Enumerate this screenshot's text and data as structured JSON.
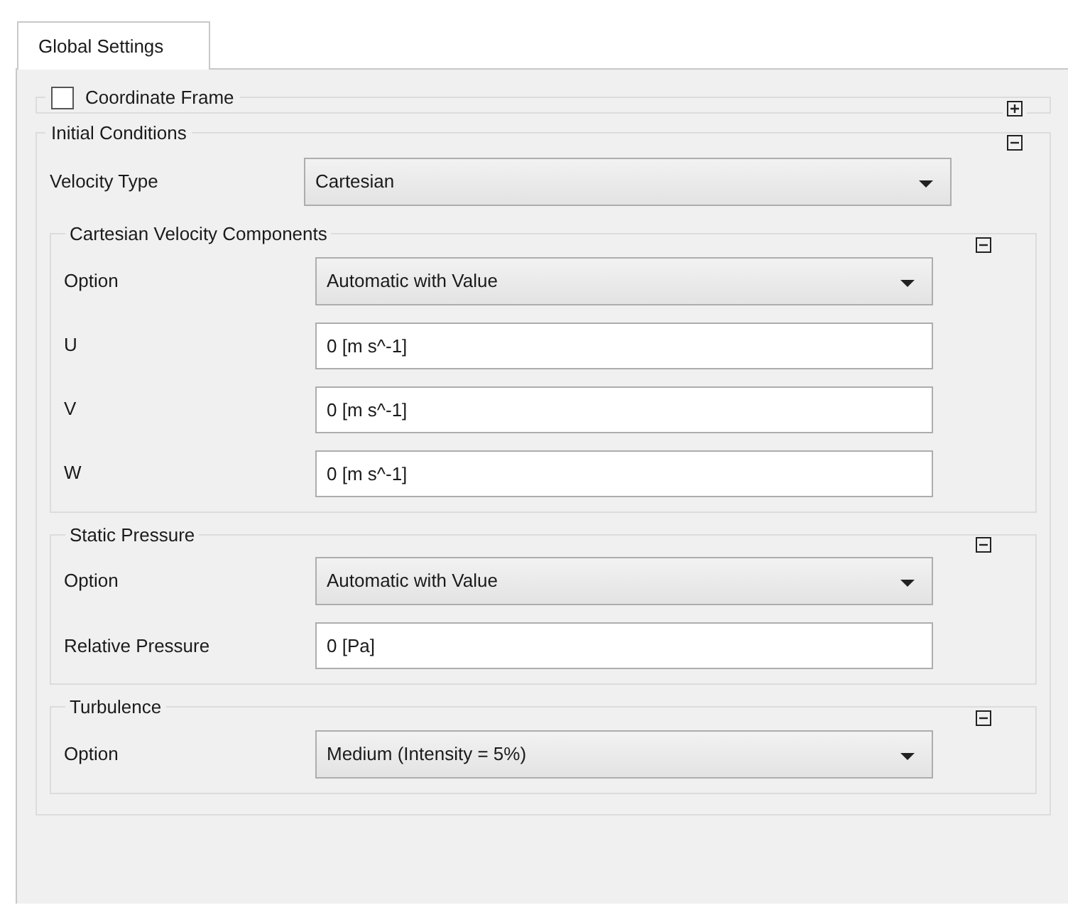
{
  "tabs": [
    {
      "label": "Global Settings",
      "selected": true
    }
  ],
  "sections": [
    {
      "kind": "checkbox",
      "title": "Coordinate Frame",
      "checked": false,
      "expanded": false
    },
    {
      "kind": "group",
      "title": "Initial Conditions",
      "expanded": true,
      "rows": [
        {
          "kind": "dropdown",
          "label": "Velocity Type",
          "value": "Cartesian"
        }
      ],
      "subgroups": [
        {
          "title": "Cartesian Velocity Components",
          "expanded": true,
          "rows": [
            {
              "kind": "dropdown",
              "label": "Option",
              "value": "Automatic with Value"
            },
            {
              "kind": "text",
              "label": "U",
              "value": "0 [m s^-1]"
            },
            {
              "kind": "text",
              "label": "V",
              "value": "0 [m s^-1]"
            },
            {
              "kind": "text",
              "label": "W",
              "value": "0 [m s^-1]"
            }
          ]
        },
        {
          "title": "Static Pressure",
          "expanded": true,
          "rows": [
            {
              "kind": "dropdown",
              "label": "Option",
              "value": "Automatic with Value"
            },
            {
              "kind": "text",
              "label": "Relative Pressure",
              "value": "0 [Pa]"
            }
          ]
        },
        {
          "title": "Turbulence",
          "expanded": true,
          "rows": [
            {
              "kind": "dropdown",
              "label": "Option",
              "value": "Medium (Intensity = 5%)"
            }
          ]
        }
      ]
    }
  ]
}
